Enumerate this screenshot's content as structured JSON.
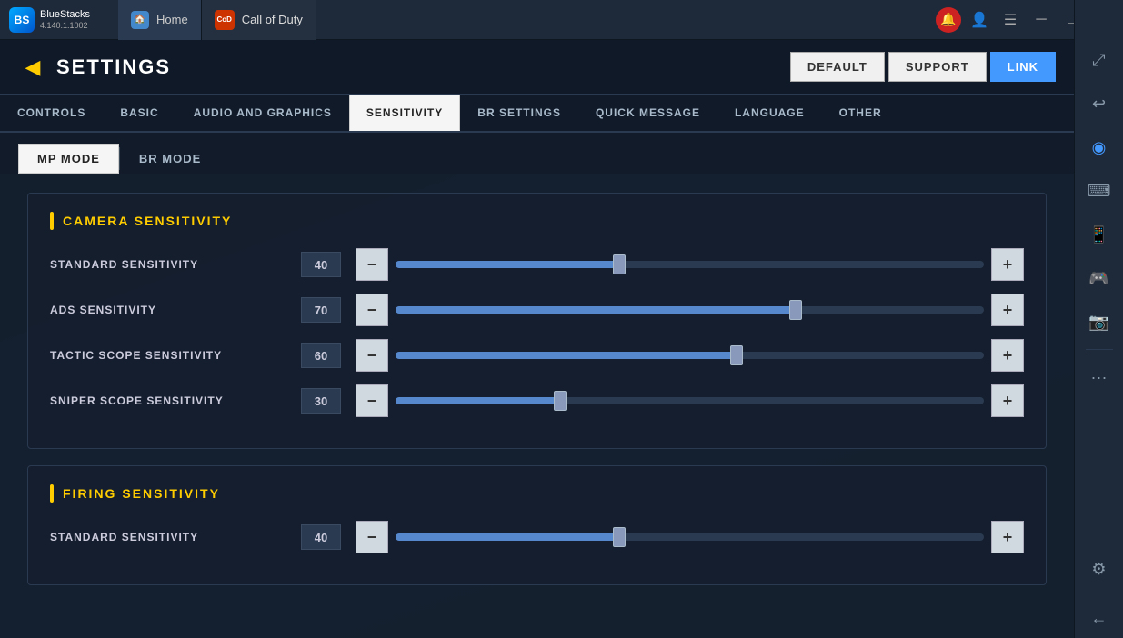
{
  "titlebar": {
    "bluestacks_name": "BlueStacks",
    "bluestacks_version": "4.140.1.1002",
    "tab_home_label": "Home",
    "tab_cod_label": "Call of Duty"
  },
  "settings": {
    "title": "SETTINGS",
    "back_label": "◀",
    "actions": {
      "default_label": "DEFAULT",
      "support_label": "SUPPORT",
      "link_label": "LINK"
    },
    "tabs": [
      {
        "label": "CONTROLS",
        "active": false
      },
      {
        "label": "BASIC",
        "active": false
      },
      {
        "label": "AUDIO AND GRAPHICS",
        "active": false
      },
      {
        "label": "SENSITIVITY",
        "active": true
      },
      {
        "label": "BR SETTINGS",
        "active": false
      },
      {
        "label": "QUICK MESSAGE",
        "active": false
      },
      {
        "label": "LANGUAGE",
        "active": false
      },
      {
        "label": "OTHER",
        "active": false
      }
    ],
    "mode_tabs": [
      {
        "label": "MP MODE",
        "active": true
      },
      {
        "label": "BR MODE",
        "active": false
      }
    ],
    "camera_section": {
      "title": "CAMERA SENSITIVITY",
      "sliders": [
        {
          "label": "STANDARD SENSITIVITY",
          "value": "40",
          "fill_pct": 38
        },
        {
          "label": "ADS SENSITIVITY",
          "value": "70",
          "fill_pct": 68
        },
        {
          "label": "TACTIC SCOPE SENSITIVITY",
          "value": "60",
          "fill_pct": 58
        },
        {
          "label": "SNIPER SCOPE SENSITIVITY",
          "value": "30",
          "fill_pct": 28
        }
      ]
    },
    "firing_section": {
      "title": "FIRING SENSITIVITY",
      "sliders": [
        {
          "label": "STANDARD SENSITIVITY",
          "value": "40",
          "fill_pct": 38
        }
      ]
    }
  },
  "sidebar": {
    "icons": [
      {
        "name": "expand-icon",
        "symbol": "⤢"
      },
      {
        "name": "back-icon",
        "symbol": "↩"
      },
      {
        "name": "eye-icon",
        "symbol": "◉"
      },
      {
        "name": "keyboard-icon",
        "symbol": "⌨"
      },
      {
        "name": "phone-icon",
        "symbol": "📱"
      },
      {
        "name": "gamepad-icon",
        "symbol": "🎮"
      },
      {
        "name": "camera-icon",
        "symbol": "📷"
      },
      {
        "name": "more-icon",
        "symbol": "···"
      },
      {
        "name": "gear-icon",
        "symbol": "⚙"
      },
      {
        "name": "back-arrow-icon",
        "symbol": "←"
      }
    ]
  }
}
